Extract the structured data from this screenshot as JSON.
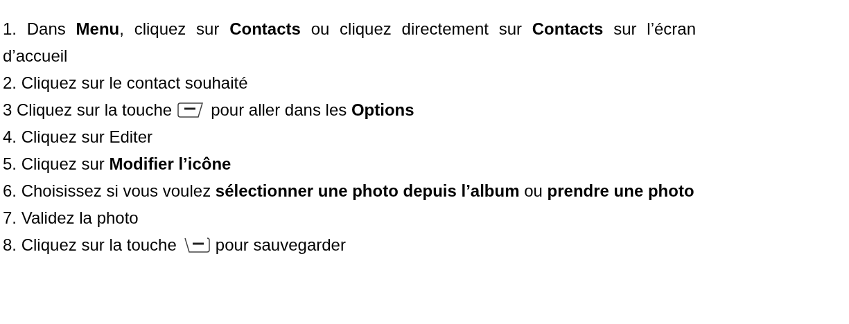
{
  "steps": [
    {
      "kind": "text",
      "text": "1. Dans **Menu**, cliquez sur **Contacts** ou cliquez directement sur **Contacts** sur l’écran d’accueil"
    },
    {
      "kind": "text",
      "text": "2. Cliquez sur le contact souhaité"
    },
    {
      "kind": "key-left",
      "before": "3 Cliquez sur la touche",
      "after": "pour aller dans les **Options**"
    },
    {
      "kind": "text",
      "text": "4. Cliquez sur Editer"
    },
    {
      "kind": "text",
      "text": "5. Cliquez sur **Modifier l’icône**"
    },
    {
      "kind": "text",
      "text": "6. Choisissez si vous voulez **sélectionner une photo depuis l’album** ou **prendre une photo**"
    },
    {
      "kind": "text",
      "text": "7. Validez la photo"
    },
    {
      "kind": "key-right",
      "before": "8. Cliquez sur la touche",
      "after": "pour sauvegarder"
    }
  ]
}
